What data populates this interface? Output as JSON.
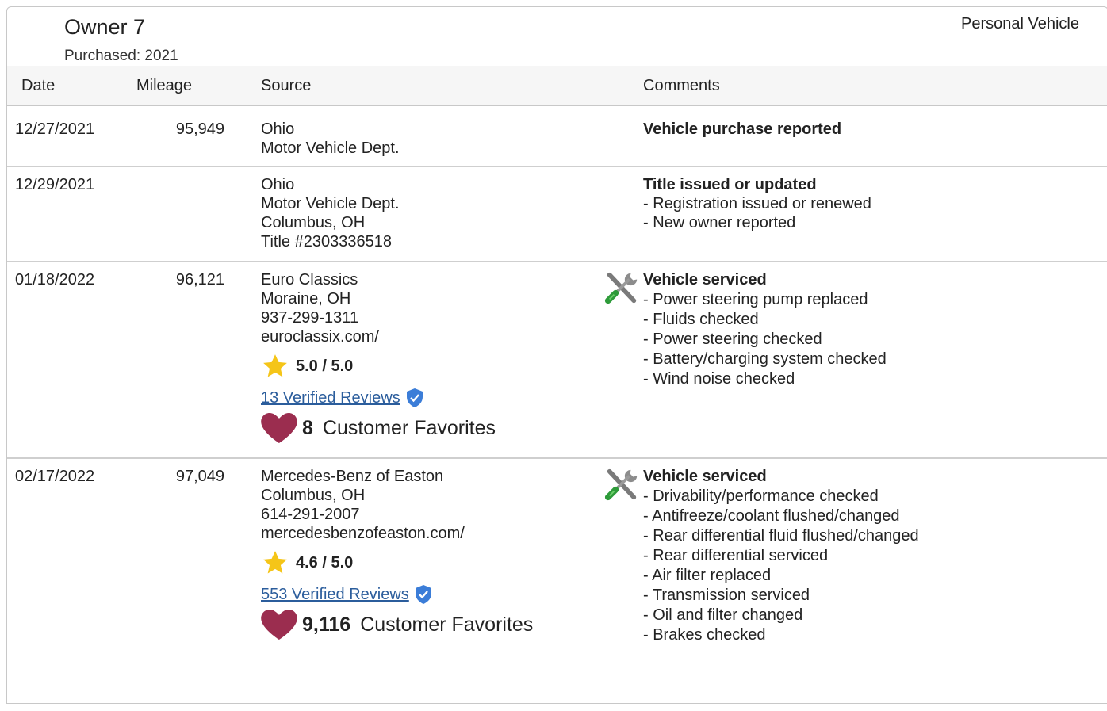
{
  "owner": {
    "title": "Owner 7",
    "purchased": "Purchased: 2021",
    "type": "Personal Vehicle"
  },
  "columns": {
    "date": "Date",
    "mileage": "Mileage",
    "source": "Source",
    "comments": "Comments"
  },
  "rows": [
    {
      "date": "12/27/2021",
      "mileage": "95,949",
      "source": [
        "Ohio",
        "Motor Vehicle Dept."
      ],
      "comment_title": "Vehicle purchase reported",
      "comment_items": []
    },
    {
      "date": "12/29/2021",
      "mileage": "",
      "source": [
        "Ohio",
        "Motor Vehicle Dept.",
        "Columbus, OH",
        "Title #2303336518"
      ],
      "comment_title": "Title issued or updated",
      "comment_items": [
        "- Registration issued or renewed",
        "- New owner reported"
      ]
    },
    {
      "date": "01/18/2022",
      "mileage": "96,121",
      "source": [
        "Euro Classics",
        "Moraine, OH",
        "937-299-1311",
        "euroclassix.com/"
      ],
      "rating": "5.0 / 5.0",
      "reviews": "13 Verified Reviews",
      "favorites_count": "8",
      "favorites_label": "Customer Favorites",
      "comment_title": "Vehicle serviced",
      "comment_items": [
        "- Power steering pump replaced",
        "- Fluids checked",
        "- Power steering checked",
        "- Battery/charging system checked",
        "- Wind noise checked"
      ]
    },
    {
      "date": "02/17/2022",
      "mileage": "97,049",
      "source": [
        "Mercedes-Benz of Easton",
        "Columbus, OH",
        "614-291-2007",
        "mercedesbenzofeaston.com/"
      ],
      "rating": "4.6 / 5.0",
      "reviews": "553 Verified Reviews",
      "favorites_count": "9,116",
      "favorites_label": "Customer Favorites",
      "comment_title": "Vehicle serviced",
      "comment_items": [
        "- Drivability/performance checked",
        "- Antifreeze/coolant flushed/changed",
        "- Rear differential fluid flushed/changed",
        "- Rear differential serviced",
        "- Air filter replaced",
        "- Transmission serviced",
        "- Oil and filter changed",
        "- Brakes checked"
      ]
    }
  ],
  "icons": {
    "star_color": "#f5c518",
    "heart_color": "#9b2d4f",
    "verified_color": "#3b7dd8",
    "wrench": "wrench-screwdriver-icon"
  }
}
